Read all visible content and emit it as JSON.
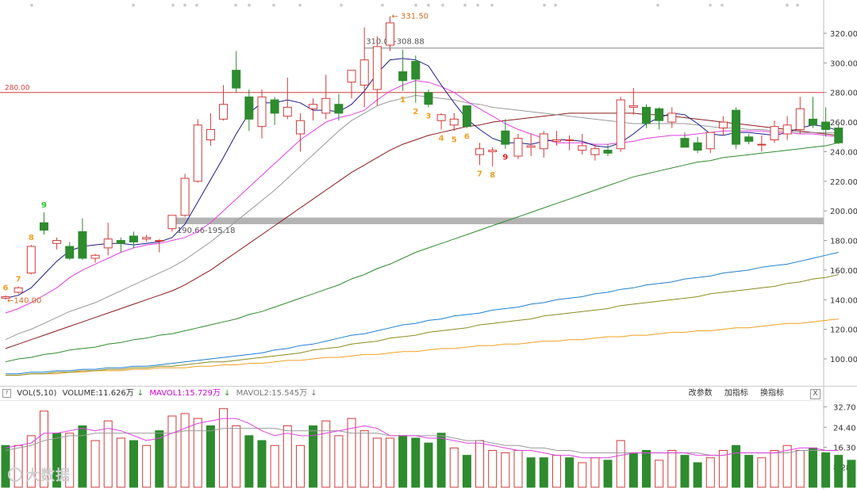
{
  "price_axis": {
    "ticks": [
      "320.00",
      "300.00",
      "280.00",
      "260.00",
      "240.00",
      "220.00",
      "200.00",
      "180.00",
      "160.00",
      "140.00",
      "120.00",
      "100.00"
    ],
    "tick_values": [
      320,
      300,
      280,
      260,
      240,
      220,
      200,
      180,
      160,
      140,
      120,
      100
    ]
  },
  "vol_axis": {
    "ticks": [
      "32.70",
      "24.40",
      "16.30",
      "8.28"
    ],
    "tick_values": [
      32.7,
      24.4,
      16.3,
      8.28
    ]
  },
  "annotations": {
    "high_label": "331.50",
    "low_label": "140.00",
    "resistance_label": "310.01-308.88",
    "support_label": "190.66-195.18",
    "hline_label": "280.00"
  },
  "vol_header": {
    "indicator": "VOL(5,10)",
    "volume": "VOLUME:11.626万",
    "mavol1": "MAVOL1:15.729万",
    "mavol2": "MAVOL2:15.545万",
    "tool_params": "改参数",
    "tool_add": "加指标",
    "tool_switch": "换指标",
    "close": "X"
  },
  "watermark": "大数据",
  "colors": {
    "up": "#d23a3a",
    "down": "#2e8b2e",
    "ma5": "#1a1a8c",
    "ma10": "#e040e0",
    "ma20": "#999999",
    "ma30": "#8b1a1a",
    "ma60": "#2e8b2e",
    "ma120": "#1e7fd0",
    "ma180": "#8b8b20",
    "ma250": "#f0a020"
  },
  "chart_data": {
    "type": "candlestick",
    "candles": [
      {
        "o": 141,
        "h": 143,
        "l": 140,
        "c": 142
      },
      {
        "o": 145,
        "h": 149,
        "l": 144,
        "c": 148
      },
      {
        "o": 158,
        "h": 177,
        "l": 157,
        "c": 176
      },
      {
        "o": 192,
        "h": 199,
        "l": 184,
        "c": 187
      },
      {
        "o": 178,
        "h": 182,
        "l": 174,
        "c": 180
      },
      {
        "o": 176,
        "h": 179,
        "l": 167,
        "c": 168
      },
      {
        "o": 186,
        "h": 195,
        "l": 167,
        "c": 168
      },
      {
        "o": 168,
        "h": 171,
        "l": 165,
        "c": 170
      },
      {
        "o": 175,
        "h": 192,
        "l": 170,
        "c": 181
      },
      {
        "o": 180,
        "h": 182,
        "l": 172,
        "c": 178
      },
      {
        "o": 183,
        "h": 186,
        "l": 175,
        "c": 179
      },
      {
        "o": 181,
        "h": 184,
        "l": 179,
        "c": 182
      },
      {
        "o": 180,
        "h": 181,
        "l": 172,
        "c": 180
      },
      {
        "o": 188,
        "h": 197,
        "l": 186,
        "c": 197
      },
      {
        "o": 197,
        "h": 225,
        "l": 196,
        "c": 222
      },
      {
        "o": 220,
        "h": 262,
        "l": 219,
        "c": 258
      },
      {
        "o": 248,
        "h": 266,
        "l": 244,
        "c": 255
      },
      {
        "o": 262,
        "h": 285,
        "l": 261,
        "c": 272
      },
      {
        "o": 295,
        "h": 308,
        "l": 280,
        "c": 283
      },
      {
        "o": 277,
        "h": 282,
        "l": 254,
        "c": 262
      },
      {
        "o": 257,
        "h": 282,
        "l": 249,
        "c": 277
      },
      {
        "o": 275,
        "h": 277,
        "l": 258,
        "c": 266
      },
      {
        "o": 264,
        "h": 290,
        "l": 262,
        "c": 270
      },
      {
        "o": 252,
        "h": 266,
        "l": 240,
        "c": 261
      },
      {
        "o": 269,
        "h": 276,
        "l": 261,
        "c": 272
      },
      {
        "o": 266,
        "h": 292,
        "l": 262,
        "c": 276
      },
      {
        "o": 272,
        "h": 279,
        "l": 261,
        "c": 266
      },
      {
        "o": 287,
        "h": 292,
        "l": 276,
        "c": 295
      },
      {
        "o": 285,
        "h": 324,
        "l": 270,
        "c": 302
      },
      {
        "o": 282,
        "h": 318,
        "l": 271,
        "c": 311
      },
      {
        "o": 312,
        "h": 331.5,
        "l": 308,
        "c": 327
      },
      {
        "o": 294,
        "h": 309,
        "l": 281,
        "c": 288
      },
      {
        "o": 301,
        "h": 305,
        "l": 273,
        "c": 289
      },
      {
        "o": 280,
        "h": 282,
        "l": 270,
        "c": 272
      },
      {
        "o": 261,
        "h": 266,
        "l": 255,
        "c": 265
      },
      {
        "o": 258,
        "h": 266,
        "l": 254,
        "c": 262
      },
      {
        "o": 271,
        "h": 271,
        "l": 256,
        "c": 257
      },
      {
        "o": 238,
        "h": 246,
        "l": 231,
        "c": 242
      },
      {
        "o": 240,
        "h": 243,
        "l": 230,
        "c": 241
      },
      {
        "o": 254,
        "h": 262,
        "l": 242,
        "c": 245
      },
      {
        "o": 237,
        "h": 252,
        "l": 235,
        "c": 249
      },
      {
        "o": 243,
        "h": 252,
        "l": 237,
        "c": 244
      },
      {
        "o": 242,
        "h": 254,
        "l": 236,
        "c": 252
      },
      {
        "o": 247,
        "h": 254,
        "l": 244,
        "c": 248
      },
      {
        "o": 248,
        "h": 251,
        "l": 241,
        "c": 248
      },
      {
        "o": 241,
        "h": 252,
        "l": 238,
        "c": 244
      },
      {
        "o": 238,
        "h": 245,
        "l": 234,
        "c": 242
      },
      {
        "o": 241,
        "h": 245,
        "l": 237,
        "c": 239
      },
      {
        "o": 242,
        "h": 277,
        "l": 240,
        "c": 275
      },
      {
        "o": 270,
        "h": 283,
        "l": 265,
        "c": 271
      },
      {
        "o": 270,
        "h": 272,
        "l": 256,
        "c": 259
      },
      {
        "o": 269,
        "h": 270,
        "l": 255,
        "c": 261
      },
      {
        "o": 260,
        "h": 270,
        "l": 256,
        "c": 266
      },
      {
        "o": 249,
        "h": 253,
        "l": 243,
        "c": 243
      },
      {
        "o": 246,
        "h": 250,
        "l": 239,
        "c": 241
      },
      {
        "o": 242,
        "h": 253,
        "l": 239,
        "c": 253
      },
      {
        "o": 256,
        "h": 264,
        "l": 251,
        "c": 260
      },
      {
        "o": 268,
        "h": 270,
        "l": 242,
        "c": 245
      },
      {
        "o": 250,
        "h": 252,
        "l": 245,
        "c": 247
      },
      {
        "o": 245,
        "h": 251,
        "l": 240,
        "c": 245
      },
      {
        "o": 248,
        "h": 261,
        "l": 246,
        "c": 257
      },
      {
        "o": 252,
        "h": 264,
        "l": 248,
        "c": 258
      },
      {
        "o": 255,
        "h": 277,
        "l": 252,
        "c": 269
      },
      {
        "o": 262,
        "h": 277,
        "l": 256,
        "c": 258
      },
      {
        "o": 260,
        "h": 270,
        "l": 250,
        "c": 255
      },
      {
        "o": 256,
        "h": 258,
        "l": 245,
        "c": 246
      }
    ],
    "volumes": [
      17,
      17,
      21,
      31,
      22,
      22,
      25,
      19,
      27,
      20,
      19,
      17,
      23,
      29,
      30,
      28,
      25,
      32,
      25,
      21,
      19,
      17,
      25,
      17,
      25,
      27,
      21,
      28,
      23,
      20,
      20,
      21,
      20,
      18,
      22,
      16,
      13,
      19,
      15,
      14,
      15,
      12,
      12,
      13,
      12,
      10,
      12,
      11,
      19,
      14,
      15,
      11,
      15,
      13,
      10,
      12,
      15,
      17,
      13,
      12,
      15,
      17,
      15,
      16,
      14,
      13,
      11
    ],
    "volume_up": [
      false,
      true,
      true,
      true,
      false,
      true,
      false,
      true,
      true,
      true,
      false,
      true,
      false,
      true,
      true,
      true,
      false,
      true,
      true,
      false,
      false,
      true,
      true,
      true,
      false,
      true,
      true,
      true,
      true,
      true,
      true,
      false,
      false,
      false,
      false,
      true,
      false,
      true,
      true,
      true,
      true,
      false,
      false,
      true,
      false,
      true,
      true,
      false,
      true,
      false,
      false,
      true,
      true,
      false,
      false,
      true,
      true,
      false,
      false,
      true,
      true,
      true,
      true,
      false,
      false,
      false,
      false
    ],
    "td_labels": [
      {
        "i": 0,
        "text": "6",
        "color": "#f0a020",
        "pos": "above"
      },
      {
        "i": 1,
        "text": "7",
        "color": "#f0a020",
        "pos": "above"
      },
      {
        "i": 2,
        "text": "8",
        "color": "#f0a020",
        "pos": "above"
      },
      {
        "i": 3,
        "text": "9",
        "color": "#28c828",
        "pos": "above"
      },
      {
        "i": 31,
        "text": "1",
        "color": "#f0a020",
        "pos": "below"
      },
      {
        "i": 32,
        "text": "2",
        "color": "#f0a020",
        "pos": "below"
      },
      {
        "i": 33,
        "text": "3",
        "color": "#f0a020",
        "pos": "below"
      },
      {
        "i": 34,
        "text": "4",
        "color": "#f0a020",
        "pos": "below"
      },
      {
        "i": 35,
        "text": "5",
        "color": "#f0a020",
        "pos": "below"
      },
      {
        "i": 36,
        "text": "6",
        "color": "#f0a020",
        "pos": "below"
      },
      {
        "i": 37,
        "text": "7",
        "color": "#f0a020",
        "pos": "below"
      },
      {
        "i": 38,
        "text": "8",
        "color": "#f0a020",
        "pos": "below"
      },
      {
        "i": 39,
        "text": "9",
        "color": "#e02020",
        "pos": "below"
      }
    ],
    "ma_lines": {
      "ma5": [
        141,
        143,
        148,
        157,
        166,
        173,
        176,
        177,
        178,
        178,
        177,
        178,
        179,
        182,
        191,
        206,
        221,
        236,
        252,
        266,
        273,
        273,
        275,
        273,
        268,
        268,
        267,
        272,
        281,
        293,
        302,
        303,
        302,
        298,
        285,
        273,
        262,
        255,
        249,
        246,
        246,
        245,
        247,
        248,
        248,
        247,
        244,
        243,
        246,
        252,
        259,
        263,
        266,
        265,
        259,
        252,
        251,
        253,
        253,
        252,
        251,
        253,
        256,
        258,
        257,
        254
      ],
      "ma10": [
        131,
        134,
        138,
        143,
        148,
        155,
        160,
        164,
        168,
        172,
        175,
        177,
        178,
        180,
        182,
        186,
        192,
        200,
        208,
        216,
        224,
        232,
        240,
        248,
        254,
        260,
        263,
        265,
        268,
        275,
        281,
        285,
        288,
        287,
        284,
        280,
        274,
        269,
        264,
        259,
        255,
        252,
        249,
        246,
        246,
        246,
        245,
        245,
        246,
        247,
        249,
        250,
        251,
        251,
        252,
        253,
        254,
        254,
        254,
        254,
        253,
        253,
        252,
        252,
        251,
        250
      ],
      "ma20": [
        113,
        117,
        120,
        124,
        128,
        132,
        135,
        138,
        142,
        146,
        150,
        154,
        158,
        162,
        167,
        173,
        179,
        186,
        193,
        200,
        207,
        214,
        222,
        230,
        238,
        246,
        254,
        261,
        266,
        271,
        274,
        276,
        278,
        277,
        276,
        275,
        273,
        272,
        270,
        269,
        268,
        267,
        266,
        265,
        264,
        263,
        262,
        261,
        260,
        259,
        259,
        259,
        259,
        259,
        258,
        257,
        256,
        256,
        255,
        255,
        254,
        254,
        253,
        253,
        253,
        253
      ],
      "ma30": [
        107,
        110,
        113,
        116,
        119,
        122,
        125,
        128,
        131,
        134,
        137,
        140,
        143,
        146,
        150,
        155,
        160,
        166,
        172,
        178,
        184,
        190,
        196,
        202,
        208,
        214,
        220,
        226,
        231,
        236,
        241,
        245,
        248,
        251,
        253,
        255,
        257,
        258,
        260,
        261,
        262,
        263,
        264,
        265,
        266,
        266,
        266,
        266,
        266,
        266,
        265,
        265,
        264,
        263,
        262,
        261,
        260,
        259,
        258,
        257,
        256,
        255,
        254,
        253,
        252,
        251
      ],
      "ma60": [
        98,
        100,
        101,
        103,
        104,
        106,
        107,
        108,
        110,
        111,
        113,
        114,
        116,
        117,
        119,
        121,
        123,
        125,
        127,
        130,
        132,
        135,
        138,
        141,
        144,
        147,
        150,
        154,
        157,
        161,
        164,
        168,
        172,
        175,
        178,
        181,
        184,
        187,
        190,
        193,
        196,
        199,
        202,
        205,
        208,
        211,
        214,
        217,
        220,
        223,
        225,
        227,
        229,
        231,
        233,
        234,
        236,
        237,
        238,
        239,
        240,
        241,
        242,
        243,
        244,
        246
      ],
      "ma120": [
        90,
        90,
        91,
        91,
        92,
        92,
        93,
        93,
        94,
        94,
        95,
        95,
        96,
        97,
        98,
        99,
        100,
        101,
        102,
        103,
        104,
        106,
        107,
        109,
        110,
        112,
        114,
        116,
        117,
        119,
        121,
        123,
        124,
        126,
        127,
        129,
        130,
        131,
        133,
        134,
        135,
        137,
        138,
        140,
        141,
        142,
        144,
        145,
        147,
        148,
        150,
        151,
        152,
        154,
        155,
        156,
        158,
        159,
        160,
        162,
        163,
        164,
        166,
        168,
        170,
        172
      ],
      "ma180": [
        89,
        89,
        90,
        90,
        91,
        91,
        92,
        92,
        93,
        93,
        94,
        94,
        95,
        95,
        96,
        97,
        98,
        98,
        99,
        100,
        101,
        102,
        103,
        104,
        106,
        107,
        108,
        110,
        111,
        112,
        114,
        115,
        116,
        118,
        119,
        120,
        121,
        123,
        124,
        125,
        126,
        127,
        129,
        130,
        131,
        132,
        133,
        134,
        136,
        137,
        138,
        139,
        140,
        141,
        142,
        144,
        145,
        146,
        147,
        148,
        149,
        151,
        152,
        154,
        155,
        157
      ],
      "ma250": [
        89,
        89,
        90,
        90,
        90,
        91,
        91,
        92,
        92,
        92,
        93,
        93,
        94,
        94,
        94,
        95,
        95,
        96,
        96,
        97,
        97,
        98,
        99,
        99,
        100,
        101,
        101,
        102,
        103,
        103,
        104,
        105,
        105,
        106,
        107,
        107,
        108,
        109,
        109,
        110,
        110,
        111,
        112,
        112,
        113,
        113,
        114,
        115,
        115,
        116,
        116,
        117,
        118,
        118,
        119,
        119,
        120,
        121,
        121,
        122,
        123,
        124,
        124,
        125,
        126,
        127
      ]
    },
    "mavol_lines": {
      "mavol1": [
        16,
        17,
        18,
        22,
        22,
        23,
        24,
        23,
        24,
        23,
        21,
        19,
        20,
        22,
        24,
        26,
        27,
        28,
        28,
        26,
        23,
        21,
        22,
        21,
        21,
        22,
        23,
        24,
        25,
        24,
        21,
        21,
        21,
        20,
        20,
        19,
        18,
        18,
        17,
        16,
        15,
        15,
        14,
        13,
        13,
        12,
        12,
        12,
        13,
        14,
        14,
        14,
        14,
        14,
        13,
        13,
        13,
        14,
        14,
        14,
        14,
        15,
        16,
        16,
        15,
        15
      ],
      "mavol2": [
        15,
        16,
        17,
        19,
        20,
        21,
        21,
        22,
        22,
        22,
        22,
        22,
        22,
        22,
        23,
        23,
        23,
        24,
        24,
        24,
        24,
        24,
        23,
        23,
        23,
        23,
        23,
        22,
        22,
        22,
        21,
        21,
        21,
        21,
        21,
        20,
        19,
        19,
        18,
        17,
        17,
        16,
        16,
        15,
        15,
        14,
        14,
        14,
        14,
        14,
        14,
        14,
        14,
        14,
        14,
        13,
        13,
        14,
        14,
        14,
        14,
        14,
        15,
        15,
        15,
        15
      ]
    },
    "price_range": [
      85,
      335
    ],
    "vol_range": [
      0,
      34.5
    ]
  }
}
